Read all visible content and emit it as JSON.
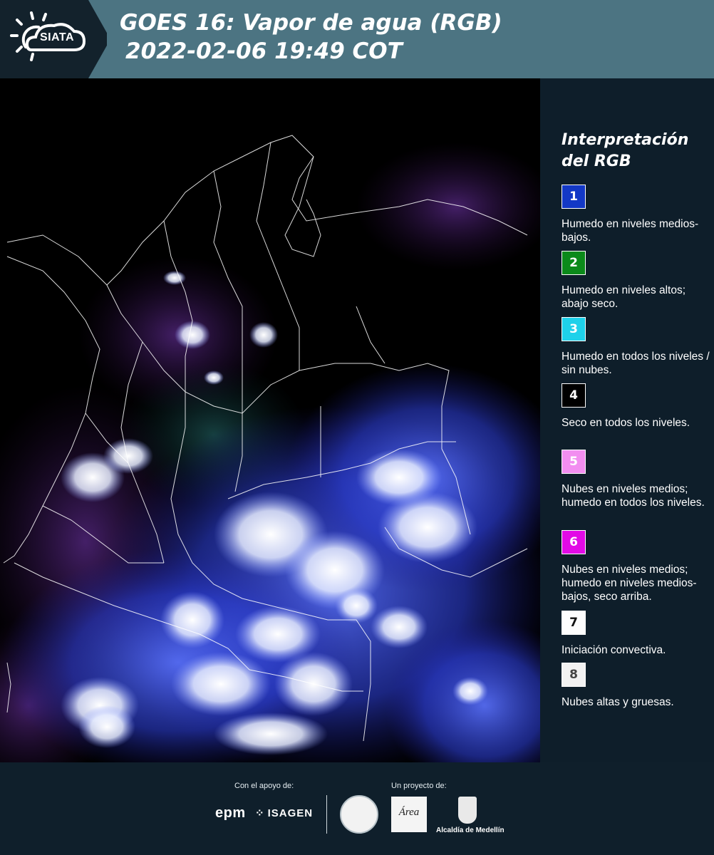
{
  "header": {
    "logo_text": "SIATA",
    "title_line1": "GOES 16: Vapor de agua (RGB)",
    "title_line2": "2022-02-06 19:49 COT"
  },
  "legend": {
    "title": "Interpretación del RGB",
    "items": [
      {
        "number": "1",
        "color": "#1338c6",
        "text_color": "#ffffff",
        "description": "Humedo en niveles medios-bajos."
      },
      {
        "number": "2",
        "color": "#0b8a1a",
        "text_color": "#ffffff",
        "description": "Humedo en niveles altos; abajo seco."
      },
      {
        "number": "3",
        "color": "#1ed1ea",
        "text_color": "#ffffff",
        "description": "Humedo en todos los niveles / sin nubes."
      },
      {
        "number": "4",
        "color": "#000000",
        "text_color": "#ffffff",
        "description": "Seco en todos los niveles."
      },
      {
        "number": "5",
        "color": "#f28ef0",
        "text_color": "#ffffff",
        "description": "Nubes en niveles medios; humedo en todos los niveles."
      },
      {
        "number": "6",
        "color": "#e20ae6",
        "text_color": "#ffffff",
        "description": "Nubes en niveles medios; humedo en niveles medios-bajos, seco arriba."
      },
      {
        "number": "7",
        "color": "#fdfdfd",
        "text_color": "#111111",
        "description": "Iniciación convectiva."
      },
      {
        "number": "8",
        "color": "#f2f2f2",
        "text_color": "#444444",
        "description": "Nubes altas y gruesas."
      }
    ]
  },
  "footer": {
    "support_label": "Con el apoyo de:",
    "project_label": "Un proyecto de:",
    "epm": "epm",
    "isagen": "ISAGEN",
    "area_metropolitana": "Área",
    "alcaldia": "Alcaldía de Medellín"
  }
}
